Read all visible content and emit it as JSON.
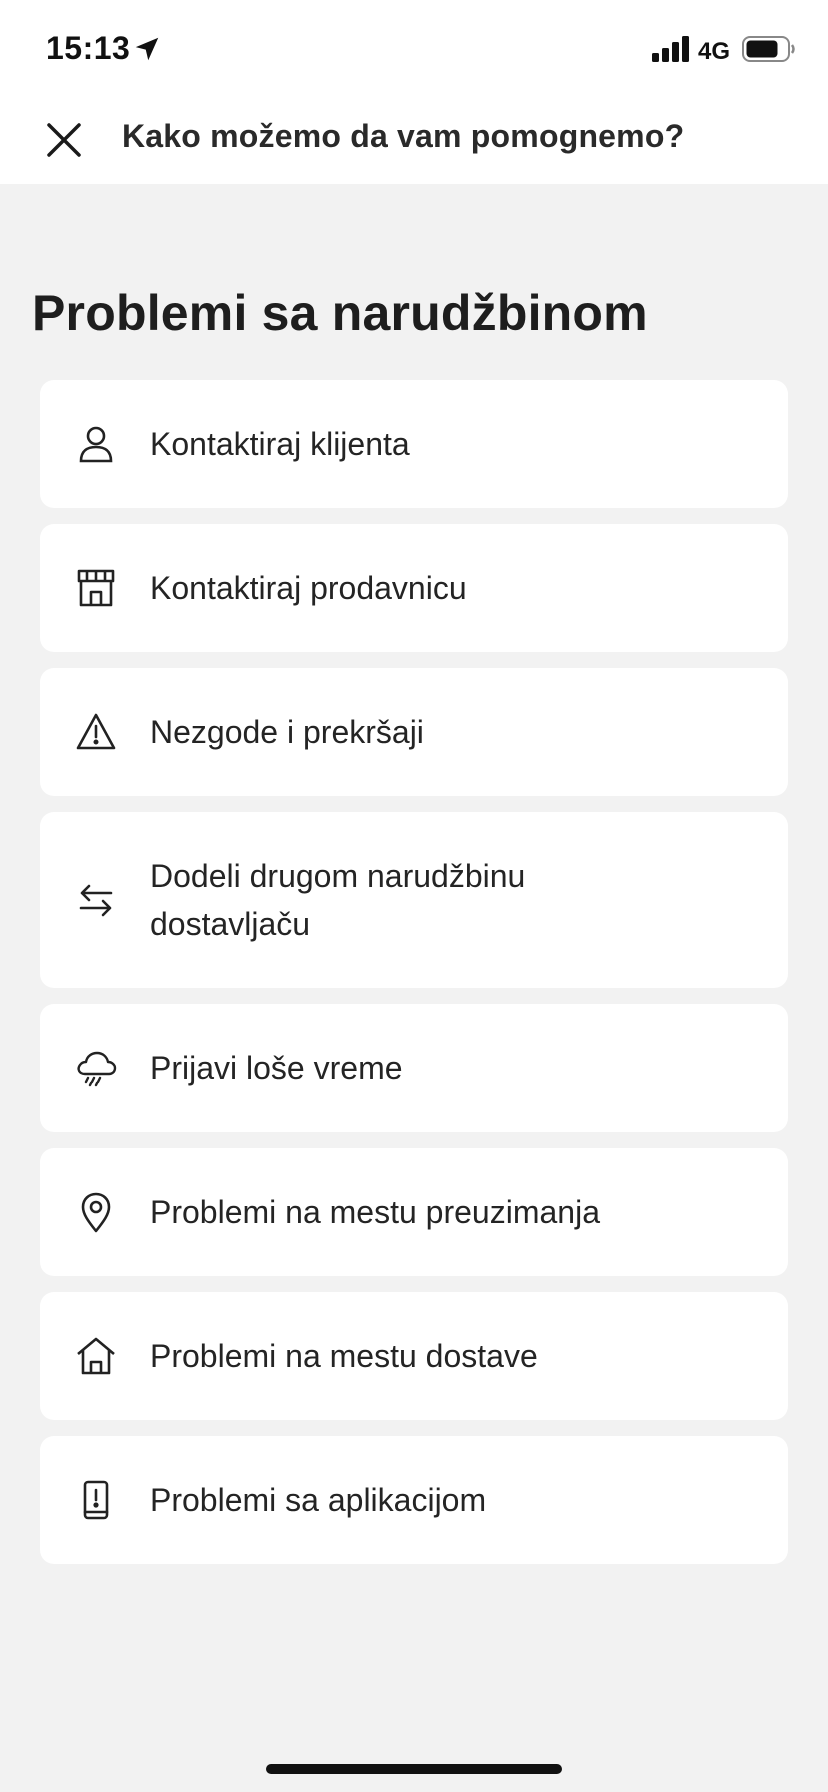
{
  "status_bar": {
    "time": "15:13",
    "network": "4G"
  },
  "header": {
    "title": "Kako možemo da vam pomognemo?"
  },
  "section": {
    "title": "Problemi sa narudžbinom"
  },
  "options": [
    {
      "label": "Kontaktiraj klijenta",
      "icon": "person-icon"
    },
    {
      "label": "Kontaktiraj prodavnicu",
      "icon": "store-icon"
    },
    {
      "label": "Nezgode i prekršaji",
      "icon": "warning-icon"
    },
    {
      "label": "Dodeli drugom narudžbinu dostavljaču",
      "icon": "swap-arrows-icon"
    },
    {
      "label": "Prijavi loše vreme",
      "icon": "rain-cloud-icon"
    },
    {
      "label": "Problemi na mestu preuzimanja",
      "icon": "location-pin-icon"
    },
    {
      "label": "Problemi na mestu dostave",
      "icon": "home-icon"
    },
    {
      "label": "Problemi sa aplikacijom",
      "icon": "phone-alert-icon"
    }
  ],
  "colors": {
    "background": "#f2f2f2",
    "card": "#ffffff",
    "text": "#242424"
  }
}
